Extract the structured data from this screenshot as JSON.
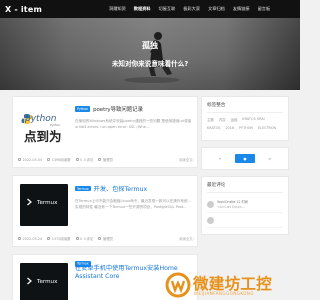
{
  "site": {
    "logo": "X - item"
  },
  "nav": [
    {
      "label": "洞爾知资",
      "active": false
    },
    {
      "label": "教程资料",
      "active": true
    },
    {
      "label": "切屋互联",
      "active": false
    },
    {
      "label": "极彩大家",
      "active": false
    },
    {
      "label": "文章归档",
      "active": false
    },
    {
      "label": "友情链接",
      "active": false
    },
    {
      "label": "留言板",
      "active": false
    }
  ],
  "hero": {
    "title": "孤独",
    "subtitle": "未知对你来说意味着什么?"
  },
  "posts": [
    {
      "badge": "Python",
      "title": "poetry导致问题记录",
      "excerpt": "在使用的Windows系统中安装poetry遇到的一些问题 是使用错误url或者urllib3.errors: run:open error: SSL (Whe...",
      "thumb": {
        "word": "python",
        "subword": "Python",
        "cn": "点到为止"
      },
      "date": "2022-05-04",
      "views": "1396阅读数",
      "comments": "0 人评论",
      "author": "管理员",
      "read_more": "阅读全文"
    },
    {
      "badge": "Termux",
      "title": "开发、包探Termux",
      "excerpt": "在Termux上可不能只会敲敲Linux命令，最近发现一款可以在操作系统... 实现的特性 最近有一个Termux一些开源的项目，PostgreSQL Post...",
      "thumb": {
        "label": "Termux"
      },
      "date": "2022-05-24",
      "views": "1370阅读数",
      "comments": "0 人评论",
      "author": "管理员",
      "read_more": "阅读全文"
    },
    {
      "badge": "Termux",
      "title": "在安卓手机中使用Termux安装Home Assistant Core",
      "excerpt": "",
      "thumb": {
        "label": "Termux"
      },
      "date": "",
      "views": "",
      "comments": "",
      "author": "",
      "read_more": ""
    }
  ],
  "sidebar": {
    "tags_title": "标签整合",
    "tags": [
      "主题",
      "内容",
      "运维",
      "KRATOS XRAI",
      "KRATOS",
      "2016",
      "PYTHON",
      "ELECTRON"
    ],
    "tabs": [
      "icon-a",
      "icon-b",
      "icon-c"
    ],
    "recent_title": "最近评论",
    "comments": [
      {
        "name": "YoshiOnebe",
        "date": "12 时间",
        "text": "<b>Cart Epsen..."
      },
      {
        "name": "",
        "date": "",
        "text": ""
      }
    ]
  },
  "watermark": {
    "text": "微建坊工控",
    "sub": "WEIJIANFANGGONGKONG"
  },
  "colors": {
    "accent": "#1a88e8",
    "header_bg": "#111111",
    "watermark": "#e8911a"
  }
}
